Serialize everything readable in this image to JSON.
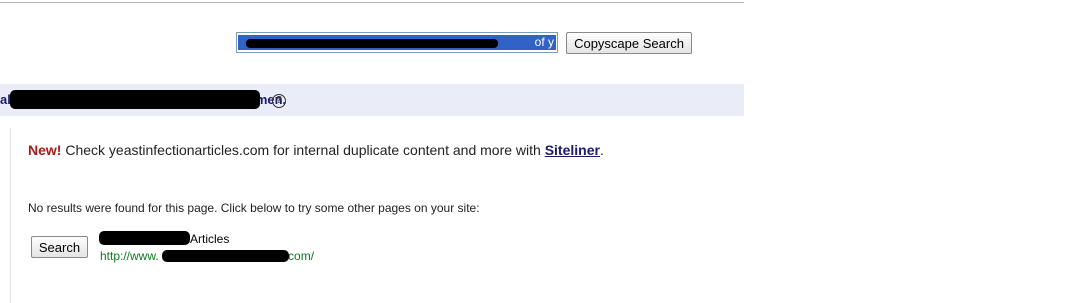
{
  "search": {
    "input_visible_tail": "of y",
    "button_label": "Copyscape Search"
  },
  "result_header": {
    "title_prefix": "al",
    "title_suffix": "Women.",
    "help_symbol": "?"
  },
  "notice": {
    "new_label": "New!",
    "text": " Check yeastinfectionarticles.com for internal duplicate content and more with ",
    "link_label": "Siteliner",
    "end": "."
  },
  "no_results_text": "No results were found for this page. Click below to try some other pages on your site:",
  "site_result": {
    "button_label": "Search",
    "title_suffix": "Articles",
    "url_prefix": "http://www.",
    "url_suffix": ".com/"
  },
  "colors": {
    "selection": "#3163c6",
    "header_band": "#eaecf8",
    "title_navy": "#1a1a6e",
    "new_red": "#aa1a1a",
    "url_green": "#0b7a1e"
  }
}
